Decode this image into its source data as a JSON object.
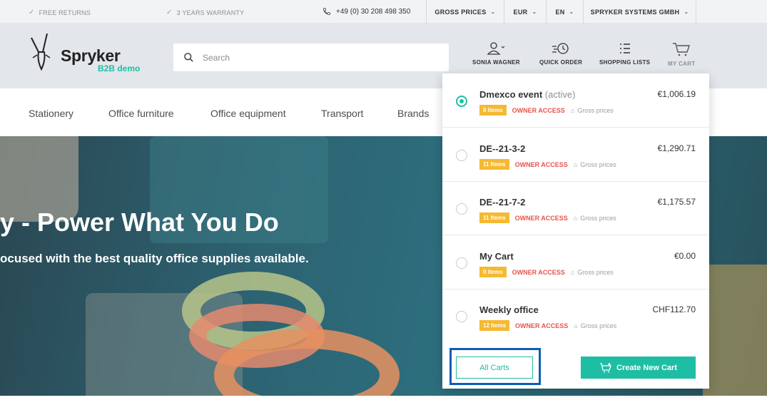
{
  "topbar": {
    "perks": [
      "FREE RETURNS",
      "3 YEARS WARRANTY"
    ],
    "phone": "+49 (0) 30 208 498 350",
    "price_mode": "GROSS PRICES",
    "currency": "EUR",
    "language": "EN",
    "company": "SPRYKER SYSTEMS GMBH"
  },
  "header": {
    "logo_name": "Spryker",
    "logo_sub": "B2B demo",
    "search_placeholder": "Search",
    "nav": {
      "user": "SONIA WAGNER",
      "quick_order": "QUICK ORDER",
      "shopping_lists": "SHOPPING LISTS",
      "my_cart": "MY CART"
    }
  },
  "categories": [
    "Stationery",
    "Office furniture",
    "Office equipment",
    "Transport",
    "Brands"
  ],
  "hero": {
    "headline": "y - Power What You Do",
    "subline": "ocused with the best quality office supplies available."
  },
  "cart_dropdown": {
    "carts": [
      {
        "name": "Dmexco event",
        "active_label": "(active)",
        "price": "€1,006.19",
        "items": "8 Items",
        "access": "OWNER ACCESS",
        "price_mode": "Gross prices",
        "selected": true
      },
      {
        "name": "DE--21-3-2",
        "active_label": "",
        "price": "€1,290.71",
        "items": "11 Items",
        "access": "OWNER ACCESS",
        "price_mode": "Gross prices",
        "selected": false
      },
      {
        "name": "DE--21-7-2",
        "active_label": "",
        "price": "€1,175.57",
        "items": "11 Items",
        "access": "OWNER ACCESS",
        "price_mode": "Gross prices",
        "selected": false
      },
      {
        "name": "My Cart",
        "active_label": "",
        "price": "€0.00",
        "items": "0 Items",
        "access": "OWNER ACCESS",
        "price_mode": "Gross prices",
        "selected": false
      },
      {
        "name": "Weekly office",
        "active_label": "",
        "price": "CHF112.70",
        "items": "12 Items",
        "access": "OWNER ACCESS",
        "price_mode": "Gross prices",
        "selected": false
      }
    ],
    "all_carts_label": "All Carts",
    "create_new_cart_label": "Create New Cart"
  },
  "colors": {
    "accent": "#1ebea5",
    "badge": "#f5b932",
    "owner_access": "#e8534c",
    "highlight_border": "#0a5fb4"
  }
}
